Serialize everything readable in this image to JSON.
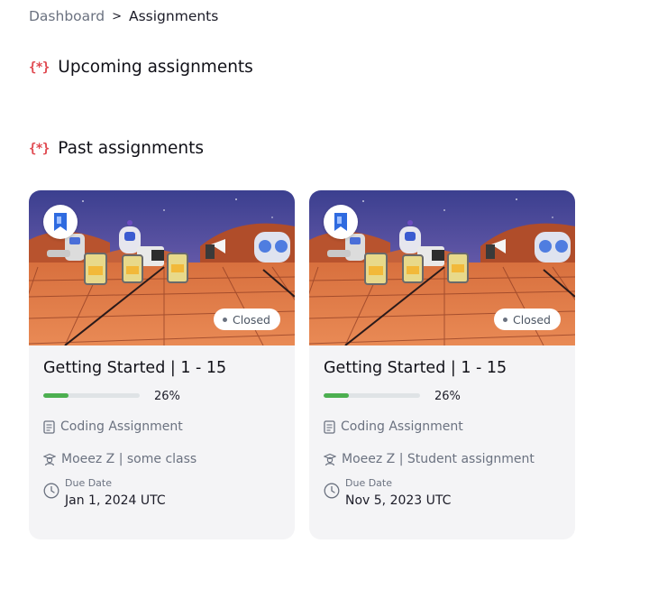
{
  "breadcrumb": {
    "parent": "Dashboard",
    "separator": ">",
    "current": "Assignments"
  },
  "sections": {
    "upcoming": {
      "icon": "{*}",
      "title": "Upcoming assignments"
    },
    "past": {
      "icon": "{*}",
      "title": "Past assignments"
    }
  },
  "cards": [
    {
      "title": "Getting Started | 1 - 15",
      "progress": 0.26,
      "progress_label": "26%",
      "status": "Closed",
      "type": "Coding Assignment",
      "owner": "Moeez Z | some class",
      "due_label": "Due Date",
      "due_value": "Jan 1, 2024 UTC"
    },
    {
      "title": "Getting Started | 1 - 15",
      "progress": 0.26,
      "progress_label": "26%",
      "status": "Closed",
      "type": "Coding Assignment",
      "owner": "Moeez Z | Student assignment",
      "due_label": "Due Date",
      "due_value": "Nov 5, 2023 UTC"
    }
  ],
  "icons": {
    "section": "code-braces-icon",
    "logo": "bookmark-logo-icon",
    "type": "document-icon",
    "owner": "student-icon",
    "due": "clock-icon"
  },
  "colors": {
    "accent_red": "#e0484f",
    "progress_green": "#4caf50",
    "card_bg": "#f4f4f6"
  }
}
